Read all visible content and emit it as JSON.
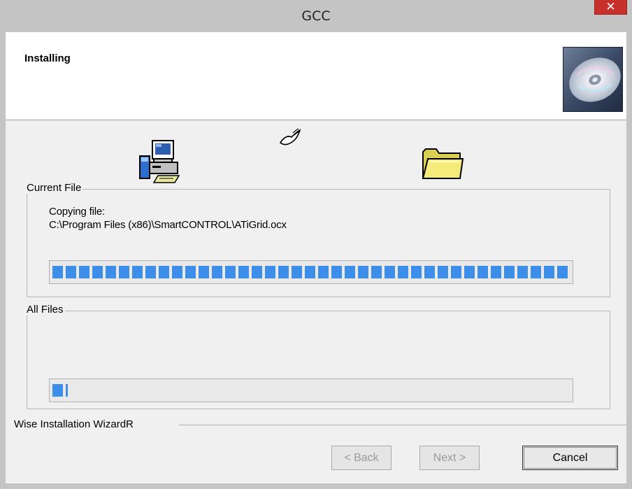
{
  "window": {
    "title": "GCC",
    "close_label": "✕"
  },
  "header": {
    "heading": "Installing"
  },
  "current_file": {
    "legend": "Current File",
    "line1": "Copying file:",
    "line2": "C:\\Program Files (x86)\\SmartCONTROL\\ATiGrid.ocx",
    "progress_percent": 100
  },
  "all_files": {
    "legend": "All Files",
    "progress_percent": 3
  },
  "footer": {
    "wizard_label": "Wise Installation WizardR"
  },
  "buttons": {
    "back": "< Back",
    "next": "Next >",
    "cancel": "Cancel"
  },
  "colors": {
    "close_red": "#c7302b",
    "progress_blue": "#3c8ee8",
    "folder_yellow": "#f4ec7a"
  },
  "icons": {
    "cd": "cd-disc-icon",
    "pc": "computer-installer-icon",
    "transfer": "flying-paper-icon",
    "folder": "folder-icon"
  }
}
